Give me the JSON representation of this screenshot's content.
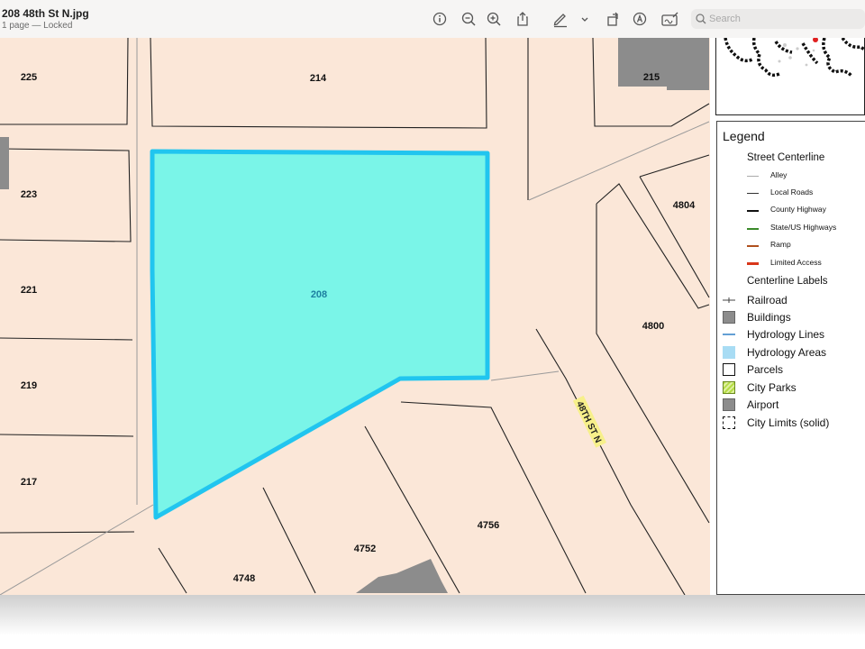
{
  "window": {
    "title": "208 48th St N.jpg",
    "subtitle": "1 page — Locked"
  },
  "toolbar": {
    "buttons": [
      "info-icon",
      "zoom-out-icon",
      "zoom-in-icon",
      "share-icon",
      "markup-pen-icon",
      "chevron-down-icon",
      "rotate-icon",
      "markup-icon",
      "signature-icon"
    ],
    "search_placeholder": "Search"
  },
  "map": {
    "street_label": "48TH ST N",
    "parcels": {
      "p225": "225",
      "p214": "214",
      "p215": "215",
      "p223": "223",
      "p4804": "4804",
      "p221": "221",
      "p208": "208",
      "p4800": "4800",
      "p219": "219",
      "p217": "217",
      "p4756": "4756",
      "p4752": "4752",
      "p4748": "4748"
    },
    "colors": {
      "background": "#fbe7d8",
      "selected_fill": "#7af5e8",
      "selected_outline": "#21c5ef",
      "buildings": "#8c8c8c"
    }
  },
  "legend": {
    "title": "Legend",
    "street_centerline": "Street Centerline",
    "street_items": [
      {
        "label": "Alley",
        "color": "#aaaaaa"
      },
      {
        "label": "Local Roads",
        "color": "#333333"
      },
      {
        "label": "County Highway",
        "color": "#111111"
      },
      {
        "label": "State/US Highways",
        "color": "#3a8a2a"
      },
      {
        "label": "Ramp",
        "color": "#b0501e"
      },
      {
        "label": "Limited Access",
        "color": "#d8361a"
      }
    ],
    "centerline_labels": "Centerline Labels",
    "items": [
      {
        "label": "Railroad",
        "swatch": "railroad"
      },
      {
        "label": "Buildings",
        "swatch": "#8c8c8c"
      },
      {
        "label": "Hydrology Lines",
        "swatch": "#2f7fc6"
      },
      {
        "label": "Hydrology Areas",
        "swatch": "#a8dcf4"
      },
      {
        "label": "Parcels",
        "swatch": "#ffffff"
      },
      {
        "label": "City Parks",
        "swatch": "#b5dd45"
      },
      {
        "label": "Airport",
        "swatch": "#8c8c8c"
      },
      {
        "label": "City Limits (solid)",
        "swatch": "dashed"
      }
    ]
  }
}
